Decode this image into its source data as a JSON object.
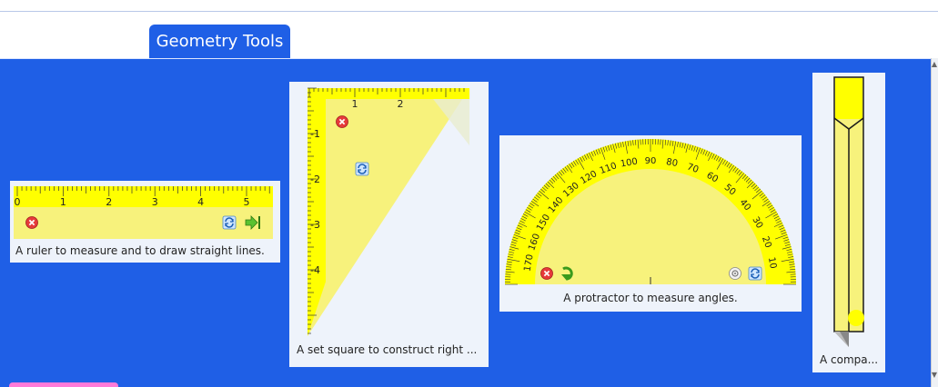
{
  "tab": {
    "label": "Geometry Tools"
  },
  "colors": {
    "panel": "#1f5fe6",
    "tool_yellow": "#f7f27c",
    "tool_yellow_dark": "#ffff00",
    "card_bg": "#eef3fb"
  },
  "tools": [
    {
      "name": "ruler",
      "caption": "A ruler to measure and to draw straight lines.",
      "tick_labels": [
        "0",
        "1",
        "2",
        "3",
        "4",
        "5"
      ],
      "icons": [
        "close-icon",
        "rotate-icon",
        "extend-icon"
      ]
    },
    {
      "name": "set-square",
      "caption": "A set square to construct right ...",
      "top_labels": [
        "1",
        "2"
      ],
      "side_labels": [
        "-1",
        "-2",
        "-3",
        "-4"
      ],
      "icons": [
        "close-icon",
        "rotate-icon"
      ]
    },
    {
      "name": "protractor",
      "caption": "A protractor to measure angles.",
      "degree_labels": [
        "10",
        "20",
        "30",
        "40",
        "50",
        "60",
        "70",
        "80",
        "90",
        "100",
        "110",
        "120",
        "130",
        "140",
        "150",
        "160",
        "170"
      ],
      "icons": [
        "close-icon",
        "flip-icon",
        "zoom-icon",
        "rotate-icon"
      ]
    },
    {
      "name": "compass",
      "caption": "A compa...",
      "icons": []
    }
  ]
}
